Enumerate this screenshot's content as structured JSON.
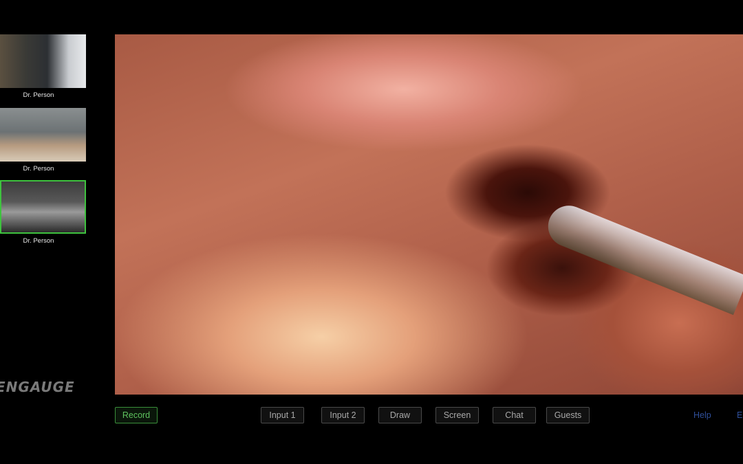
{
  "participants": [
    {
      "name": "Dr. Person",
      "active": false
    },
    {
      "name": "Dr. Person",
      "active": false
    },
    {
      "name": "Dr. Person",
      "active": true
    }
  ],
  "brand": {
    "logo_text": "ENGAUGE"
  },
  "toolbar": {
    "record_label": "Record",
    "buttons": [
      "Input 1",
      "Input 2",
      "Draw",
      "Screen",
      "Chat",
      "Guests"
    ],
    "help_label": "Help",
    "exit_partial_label": "E"
  },
  "colors": {
    "active_border": "#3fc23f",
    "record": "#5ec25e",
    "link": "#2f4f9a"
  }
}
